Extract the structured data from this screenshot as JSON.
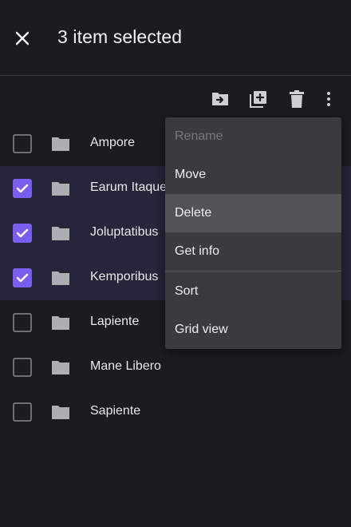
{
  "header": {
    "title": "3 item selected"
  },
  "toolbar": {
    "icons": [
      "move-to-folder-icon",
      "add-to-collection-icon",
      "delete-icon",
      "more-vert-icon"
    ]
  },
  "list": {
    "items": [
      {
        "label": "Ampore",
        "selected": false
      },
      {
        "label": "Earum Itaque",
        "selected": true
      },
      {
        "label": "Joluptatibus",
        "selected": true
      },
      {
        "label": "Kemporibus",
        "selected": true
      },
      {
        "label": "Lapiente",
        "selected": false
      },
      {
        "label": "Mane Libero",
        "selected": false
      },
      {
        "label": "Sapiente",
        "selected": false
      }
    ]
  },
  "menu": {
    "items": [
      {
        "label": "Rename",
        "disabled": true
      },
      {
        "label": "Move",
        "disabled": false
      },
      {
        "label": "Delete",
        "disabled": false,
        "highlighted": true
      },
      {
        "label": "Get info",
        "disabled": false
      },
      {
        "label": "Sort",
        "disabled": false
      },
      {
        "label": "Grid view",
        "disabled": false
      }
    ]
  },
  "colors": {
    "background": "#1b1c1e",
    "selected_row": "#26263a",
    "accent": "#7b5cf0",
    "menu_bg": "#3b3b3e",
    "menu_highlight": "#545457"
  }
}
